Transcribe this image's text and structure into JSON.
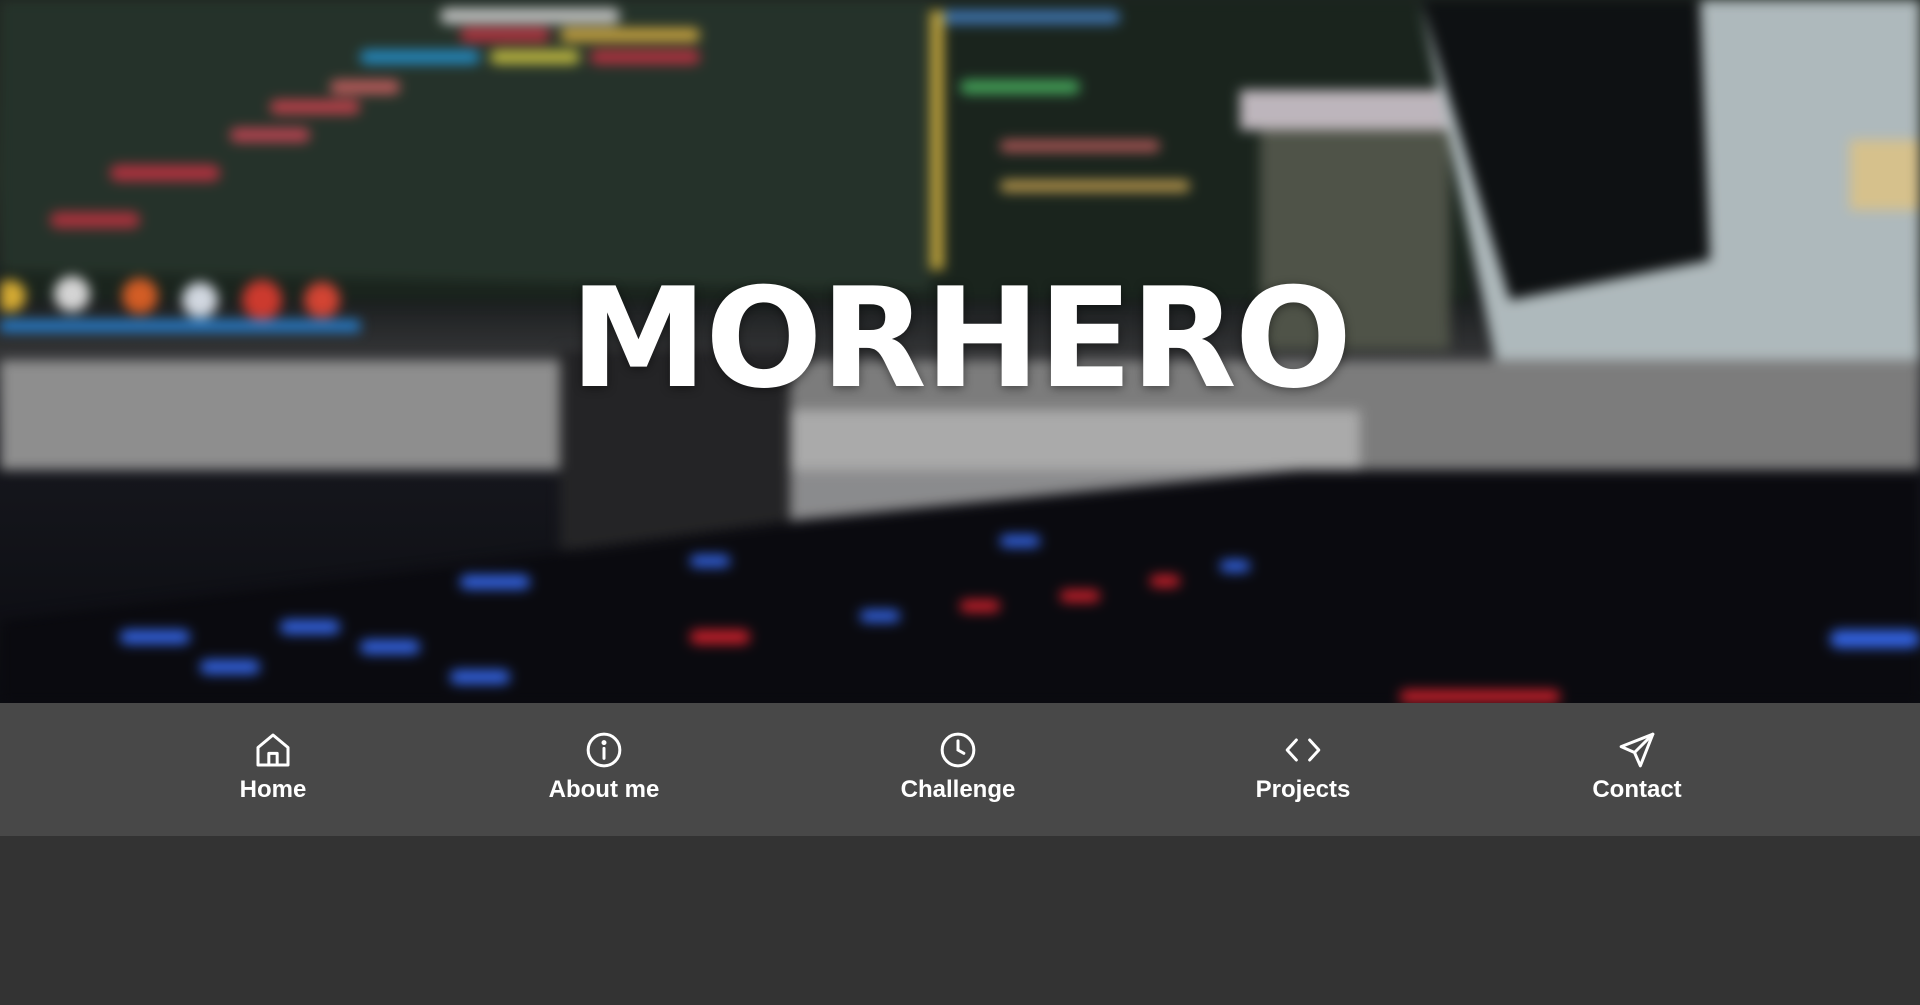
{
  "hero": {
    "title": "MORHERO"
  },
  "nav": {
    "items": [
      {
        "label": "Home",
        "icon": "home-icon"
      },
      {
        "label": "About me",
        "icon": "info-icon"
      },
      {
        "label": "Challenge",
        "icon": "clock-icon"
      },
      {
        "label": "Projects",
        "icon": "code-icon"
      },
      {
        "label": "Contact",
        "icon": "send-icon"
      }
    ]
  },
  "colors": {
    "navbar_bg": "#484848",
    "page_bg": "#333333",
    "text": "#ffffff"
  }
}
